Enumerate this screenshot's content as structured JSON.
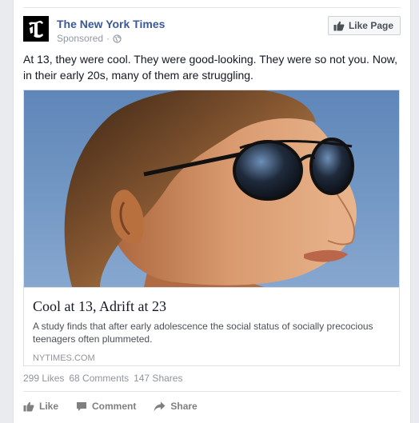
{
  "post": {
    "page_name": "The New York Times",
    "sponsored_label": "Sponsored",
    "separator": "·",
    "like_page_label": "Like Page",
    "text": "At 13, they were cool. They were good-looking. They were so not you. Now, in their early 20s, many of them are struggling.",
    "link": {
      "title": "Cool at 13, Adrift at 23",
      "description": "A study finds that after early adolescence the social status of socially precocious teenagers often plummeted.",
      "domain": "NYTIMES.COM"
    },
    "stats": {
      "likes": "299 Likes",
      "comments": "68 Comments",
      "shares": "147 Shares"
    },
    "actions": {
      "like": "Like",
      "comment": "Comment",
      "share": "Share"
    }
  },
  "colors": {
    "brand_link": "#3b5998",
    "muted": "#9197a3",
    "action": "#7f7f7f"
  },
  "icons": {
    "logo": "nyt-t-logo",
    "privacy": "globe-icon",
    "like_page": "thumbs-up-icon",
    "like": "thumbs-up-icon",
    "comment": "comment-bubble-icon",
    "share": "share-arrow-icon"
  }
}
